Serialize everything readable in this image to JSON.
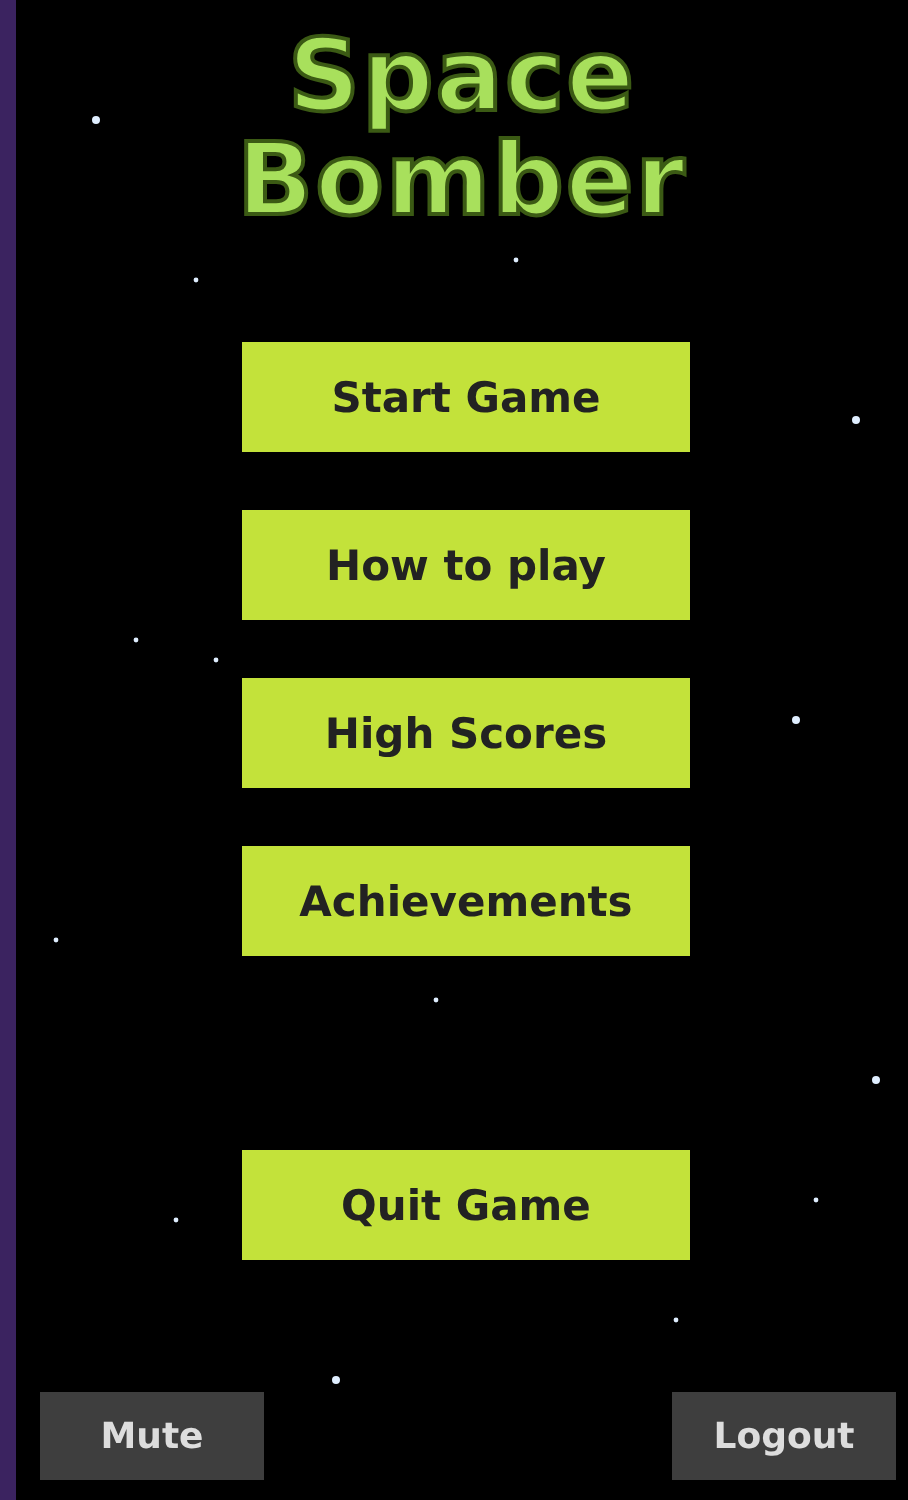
{
  "title": [
    "Space",
    "Bomber"
  ],
  "menu": [
    {
      "label": "Start Game"
    },
    {
      "label": "How to play"
    },
    {
      "label": "High Scores"
    },
    {
      "label": "Achievements"
    },
    {
      "label": "Quit Game"
    }
  ],
  "footer": {
    "mute": "Mute",
    "logout": "Logout"
  }
}
